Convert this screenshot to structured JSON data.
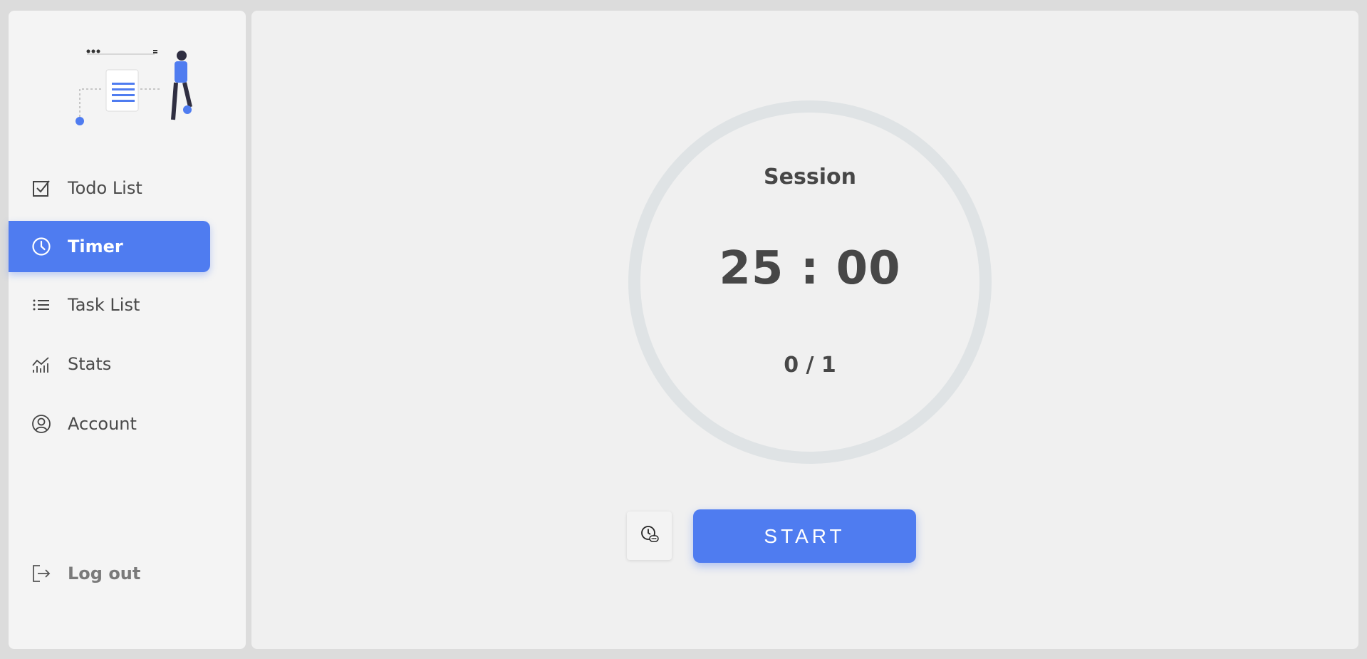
{
  "sidebar": {
    "items": [
      {
        "label": "Todo List",
        "icon": "checkbox-icon"
      },
      {
        "label": "Timer",
        "icon": "clock-icon",
        "active": true
      },
      {
        "label": "Task List",
        "icon": "list-icon"
      },
      {
        "label": "Stats",
        "icon": "chart-icon"
      },
      {
        "label": "Account",
        "icon": "user-circle-icon"
      }
    ],
    "logout": {
      "label": "Log out",
      "icon": "logout-icon"
    }
  },
  "timer": {
    "session_label": "Session",
    "time": "25 : 00",
    "count": "0 / 1",
    "start_label": "START"
  },
  "colors": {
    "accent": "#4f7cf0",
    "ring": "#dfe3e5",
    "text": "#474747"
  }
}
